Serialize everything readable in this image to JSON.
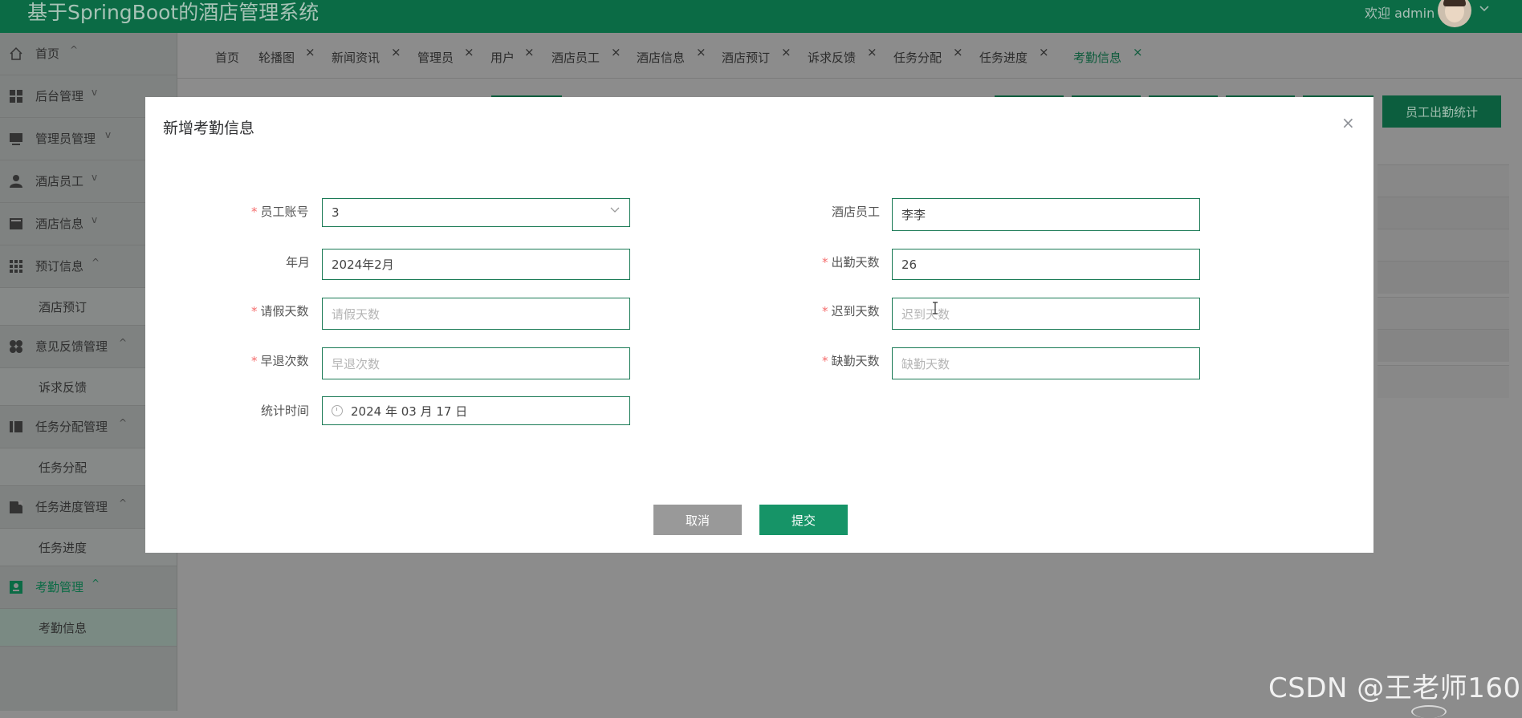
{
  "header": {
    "app_title": "基于SpringBoot的酒店管理系统",
    "welcome": "欢迎 admin",
    "user_menu_icon": "chevron-down-icon"
  },
  "sidebar": {
    "items": [
      {
        "label": "首页",
        "icon": "home-icon",
        "arrow": "^"
      },
      {
        "label": "后台管理",
        "icon": "grid-icon",
        "arrow": "v"
      },
      {
        "label": "管理员管理",
        "icon": "monitor-icon",
        "arrow": "v"
      },
      {
        "label": "酒店员工",
        "icon": "user-icon",
        "arrow": "v"
      },
      {
        "label": "酒店信息",
        "icon": "card-icon",
        "arrow": "v"
      },
      {
        "label": "预订信息",
        "icon": "apps-icon",
        "arrow": "^"
      },
      {
        "label": "意见反馈管理",
        "icon": "dots-icon",
        "arrow": "^"
      },
      {
        "label": "任务分配管理",
        "icon": "book-icon",
        "arrow": "^"
      },
      {
        "label": "任务进度管理",
        "icon": "doc-icon",
        "arrow": "^"
      },
      {
        "label": "考勤管理",
        "icon": "badge-icon",
        "arrow": "^"
      }
    ],
    "subitems": {
      "booking": "酒店预订",
      "feedback": "诉求反馈",
      "task_assign": "任务分配",
      "task_progress": "任务进度",
      "attendance": "考勤信息"
    }
  },
  "tabs": [
    {
      "label": "首页",
      "closable": false
    },
    {
      "label": "轮播图",
      "closable": true
    },
    {
      "label": "新闻资讯",
      "closable": true
    },
    {
      "label": "管理员",
      "closable": true
    },
    {
      "label": "用户",
      "closable": true
    },
    {
      "label": "酒店员工",
      "closable": true
    },
    {
      "label": "酒店信息",
      "closable": true
    },
    {
      "label": "酒店预订",
      "closable": true
    },
    {
      "label": "诉求反馈",
      "closable": true
    },
    {
      "label": "任务分配",
      "closable": true
    },
    {
      "label": "任务进度",
      "closable": true
    },
    {
      "label": "考勤信息",
      "closable": true,
      "active": true
    }
  ],
  "tab_close_glyph": "×",
  "page": {
    "stat_button": "员工出勤统计"
  },
  "modal": {
    "title": "新增考勤信息",
    "close_glyph": "×",
    "fields": {
      "staff_account": {
        "label": "员工账号",
        "value": "3",
        "required": true
      },
      "staff_name": {
        "label": "酒店员工",
        "value": "李李",
        "required": false
      },
      "year_month": {
        "label": "年月",
        "value": "2024年2月",
        "required": false
      },
      "attendance_days": {
        "label": "出勤天数",
        "value": "26",
        "required": true
      },
      "leave_days": {
        "label": "请假天数",
        "placeholder": "请假天数",
        "required": true
      },
      "late_days": {
        "label": "迟到天数",
        "placeholder": "迟到天数",
        "required": true
      },
      "early_leave": {
        "label": "早退次数",
        "placeholder": "早退次数",
        "required": true
      },
      "absent_days": {
        "label": "缺勤天数",
        "placeholder": "缺勤天数",
        "required": true
      },
      "stat_time": {
        "label": "统计时间",
        "value": "2024 年 03 月 17 日",
        "required": false
      }
    },
    "required_mark": "*",
    "cancel_label": "取消",
    "submit_label": "提交"
  },
  "watermark": "CSDN @王老师160"
}
